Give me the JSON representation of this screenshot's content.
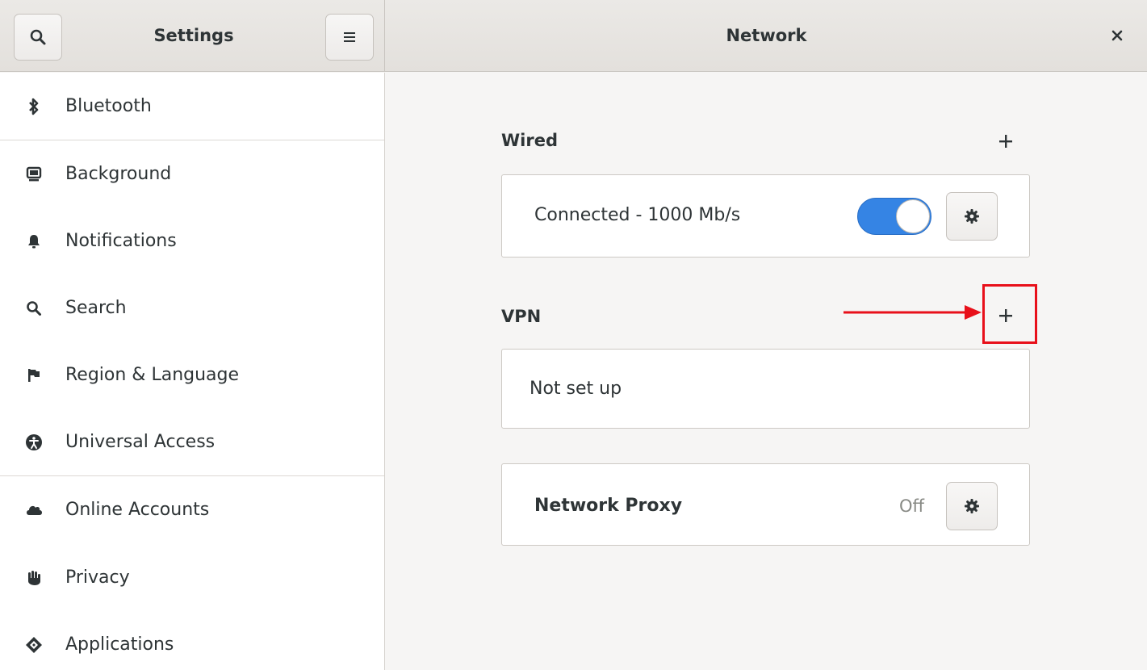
{
  "header": {
    "sidebar_title": "Settings",
    "panel_title": "Network"
  },
  "sidebar": {
    "items": [
      {
        "label": "Bluetooth",
        "icon": "bluetooth-icon"
      },
      {
        "label": "Background",
        "icon": "monitor-icon"
      },
      {
        "label": "Notifications",
        "icon": "bell-icon"
      },
      {
        "label": "Search",
        "icon": "search-icon"
      },
      {
        "label": "Region & Language",
        "icon": "flag-icon"
      },
      {
        "label": "Universal Access",
        "icon": "accessibility-icon"
      },
      {
        "label": "Online Accounts",
        "icon": "cloud-icon"
      },
      {
        "label": "Privacy",
        "icon": "hand-icon"
      },
      {
        "label": "Applications",
        "icon": "applications-icon"
      }
    ]
  },
  "wired": {
    "title": "Wired",
    "status": "Connected - 1000 Mb/s",
    "toggle_on": true
  },
  "vpn": {
    "title": "VPN",
    "status": "Not set up"
  },
  "proxy": {
    "label": "Network Proxy",
    "state": "Off"
  },
  "colors": {
    "accent": "#3584e4",
    "annotation": "#e8101a"
  }
}
